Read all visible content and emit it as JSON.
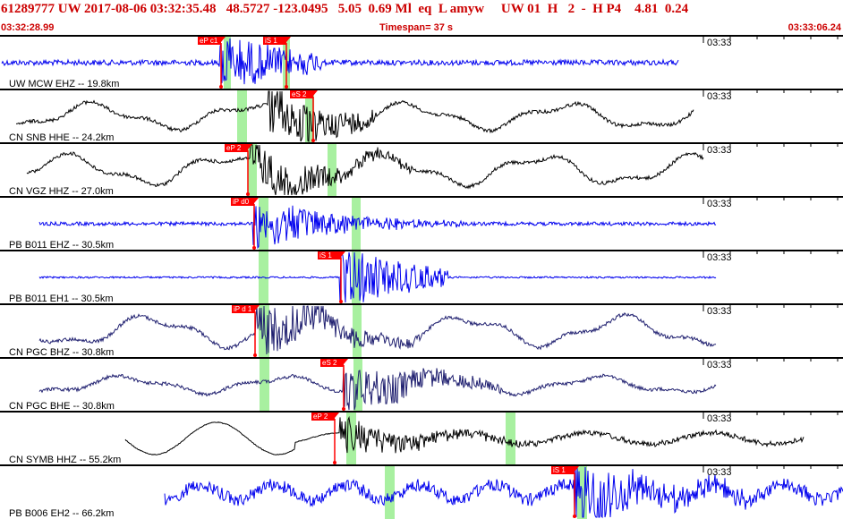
{
  "header": {
    "title": "61289777 UW 2017-08-06 03:32:35.48   48.5727 -123.0495   5.05  0.69 Ml  eq  L amyw     UW 01  H   2  -  H P4    4.81  0.24",
    "start_time": "03:32:28.99",
    "timespan_label": "Timespan=  37 s",
    "end_time": "03:33:06.24"
  },
  "colors": {
    "pick_red": "#ff0000",
    "window_green": "#a8f0a0",
    "header_red": "#cc0000",
    "trace_blue": "#0000ee",
    "trace_black": "#000000",
    "trace_navy": "#202070"
  },
  "traces": [
    {
      "label": "UW MCW EHZ -- 19.8km",
      "time_label": "03:33",
      "color": "#0000ee",
      "picks": [
        {
          "label": "eP c1"
        },
        {
          "label": "iS 1"
        }
      ]
    },
    {
      "label": "CN SNB HHE -- 24.2km",
      "time_label": "03:33",
      "color": "#000000",
      "picks": [
        {
          "label": "eS 2"
        }
      ]
    },
    {
      "label": "CN VGZ HHZ -- 27.0km",
      "time_label": "03:33",
      "color": "#000000",
      "picks": [
        {
          "label": "eP 2"
        }
      ]
    },
    {
      "label": "PB B011 EHZ -- 30.5km",
      "time_label": "03:33",
      "color": "#0000ee",
      "picks": [
        {
          "label": "iP d0"
        }
      ]
    },
    {
      "label": "PB B011 EH1 -- 30.5km",
      "time_label": "03:33",
      "color": "#0000ee",
      "picks": [
        {
          "label": "iS 1"
        }
      ]
    },
    {
      "label": "CN PGC BHZ -- 30.8km",
      "time_label": "03:33",
      "color": "#202070",
      "picks": [
        {
          "label": "iP d 1"
        }
      ]
    },
    {
      "label": "CN PGC BHE -- 30.8km",
      "time_label": "03:33",
      "color": "#202070",
      "picks": [
        {
          "label": "eS 2"
        }
      ]
    },
    {
      "label": "CN SYMB HHZ -- 55.2km",
      "time_label": "03:33",
      "color": "#000000",
      "picks": [
        {
          "label": "eP 2"
        }
      ]
    },
    {
      "label": "PB B006 EH2 -- 66.2km",
      "time_label": "03:33",
      "color": "#0000ee",
      "picks": [
        {
          "label": "iS 1"
        }
      ]
    }
  ]
}
